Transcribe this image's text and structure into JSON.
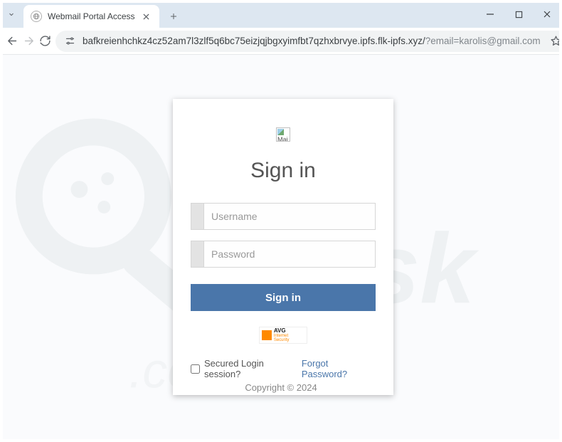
{
  "browser": {
    "tab_title": "Webmail Portal Access",
    "url_main": "bafkreienhchkz4cz52am7l3zlf5q6bc75eizjqjbgxyimfbt7qzhxbrvye.ipfs.flk-ipfs.xyz/",
    "url_query": "?email=karolis@gmail.com"
  },
  "card": {
    "title": "Sign in",
    "username_placeholder": "Username",
    "password_placeholder": "Password",
    "signin_label": "Sign in",
    "avg_brand": "AVG",
    "avg_sub": "Internet Security",
    "secured_label": "Secured Login session?",
    "forgot_label": "Forgot Password?",
    "broken_alt": "Mai"
  },
  "footer": {
    "copyright": "Copyright © 2024"
  },
  "colors": {
    "accent": "#4a76aa"
  }
}
